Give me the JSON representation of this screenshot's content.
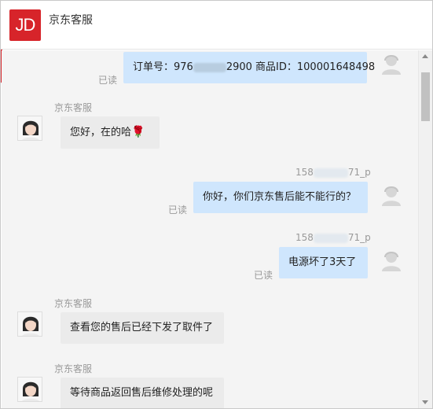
{
  "header": {
    "logo_text": "JD",
    "title": "京东客服"
  },
  "messages": [
    {
      "type": "out",
      "text": "订单号：976",
      "text_tail": "2900 商品ID：100001648498",
      "read": "已读"
    },
    {
      "type": "in",
      "sender": "京东客服",
      "text": "您好，在的哈",
      "emoji": "rose-icon"
    },
    {
      "type": "out",
      "sender_prefix": "158",
      "sender_suffix": "71_p",
      "text": "你好，你们京东售后能不能行的？",
      "read": "已读"
    },
    {
      "type": "out",
      "sender_prefix": "158",
      "sender_suffix": "71_p",
      "text": "电源坏了3天了",
      "read": "已读"
    },
    {
      "type": "in",
      "sender": "京东客服",
      "text": "查看您的售后已经下发了取件了"
    },
    {
      "type": "in",
      "sender": "京东客服",
      "text": "等待商品返回售后维修处理的呢"
    }
  ],
  "colors": {
    "brand": "#d7242a",
    "outgoing_bubble": "#cfe6fd",
    "incoming_bubble": "#ebebeb",
    "chat_bg": "#f4f4f4"
  }
}
